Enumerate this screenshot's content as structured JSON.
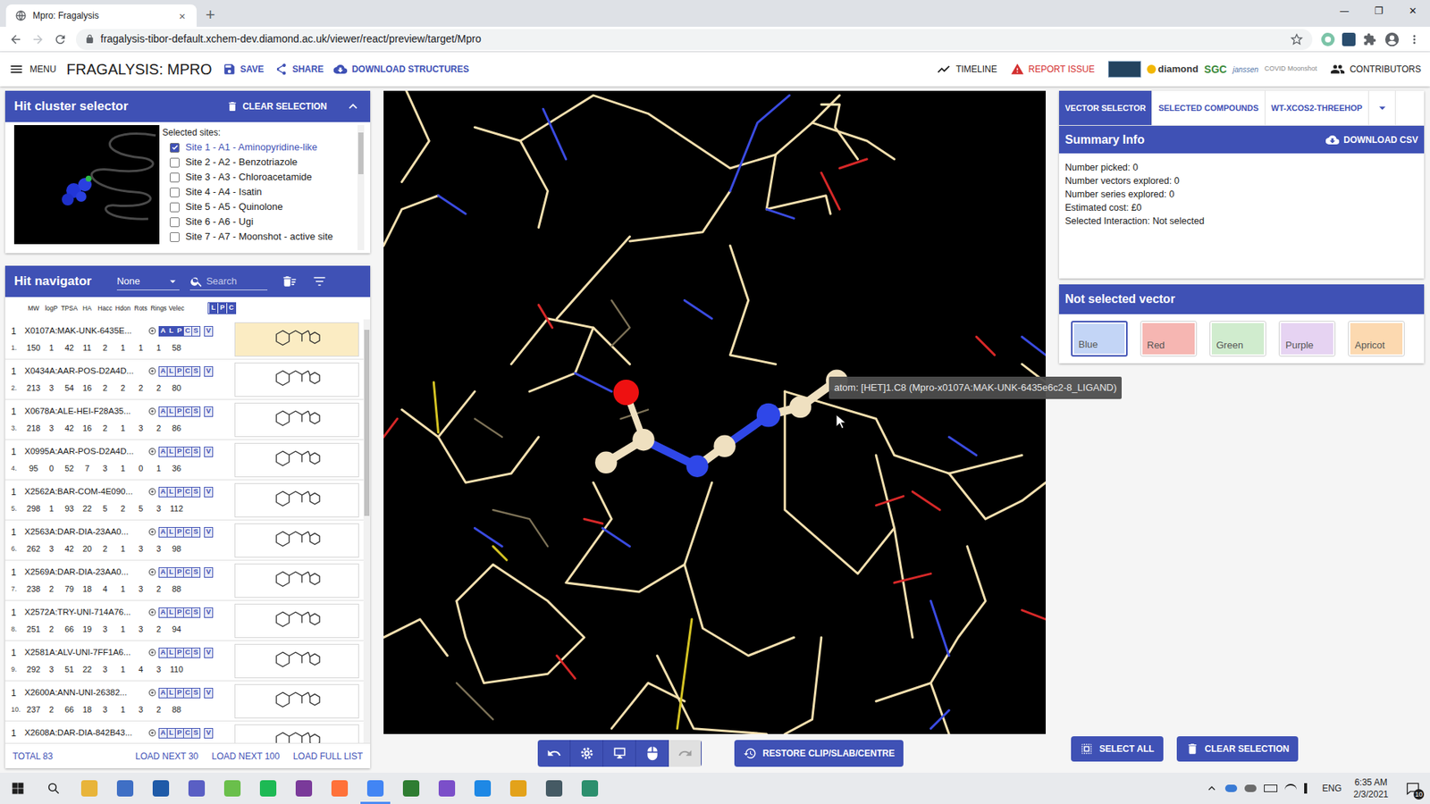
{
  "browser": {
    "tab_title": "Mpro: Fragalysis",
    "tab_close": "×",
    "new_tab": "+",
    "window_controls": [
      "—",
      "❐",
      "✕"
    ],
    "url": "fragalysis-tibor-default.xchem-dev.diamond.ac.uk/viewer/react/preview/target/Mpro"
  },
  "app_header": {
    "menu": "MENU",
    "title": "FRAGALYSIS: MPRO",
    "actions": [
      "SAVE",
      "SHARE",
      "DOWNLOAD STRUCTURES"
    ],
    "timeline": "TIMELINE",
    "report_issue": "REPORT ISSUE",
    "logos": [
      "diamond",
      "SGC",
      "janssen",
      "COVID Moonshot"
    ],
    "contributors": "CONTRIBUTORS"
  },
  "hit_cluster_selector": {
    "title": "Hit cluster selector",
    "clear": "CLEAR SELECTION",
    "sites_label": "Selected sites:",
    "sites": [
      {
        "label": "Site 1 - A1 - Aminopyridine-like",
        "checked": true
      },
      {
        "label": "Site 2 - A2 - Benzotriazole",
        "checked": false
      },
      {
        "label": "Site 3 - A3 - Chloroacetamide",
        "checked": false
      },
      {
        "label": "Site 4 - A4 - Isatin",
        "checked": false
      },
      {
        "label": "Site 5 - A5 - Quinolone",
        "checked": false
      },
      {
        "label": "Site 6 - A6 - Ugi",
        "checked": false
      },
      {
        "label": "Site 7 - A7 - Moonshot - active site",
        "checked": false
      }
    ]
  },
  "hit_navigator": {
    "title": "Hit navigator",
    "filter": "None",
    "search_placeholder": "Search",
    "columns": [
      "MW",
      "logP",
      "TPSA",
      "HA",
      "Hacc",
      "Hdon",
      "Rots",
      "Rings",
      "Velec"
    ],
    "header_badges": [
      "L",
      "P",
      "C"
    ],
    "rows": [
      {
        "count": "1",
        "name": "X0107A:MAK-UNK-6435E...",
        "index": "1.",
        "values": [
          "150",
          "1",
          "42",
          "11",
          "2",
          "1",
          "1",
          "1",
          "58"
        ],
        "selected": true,
        "badges": [
          {
            "label": "A",
            "on": true
          },
          {
            "label": "L",
            "on": true
          },
          {
            "label": "P",
            "on": true
          },
          {
            "label": "C",
            "on": false
          },
          {
            "label": "S",
            "on": false
          },
          {
            "label": "V",
            "on": false
          }
        ]
      },
      {
        "count": "1",
        "name": "X0434A:AAR-POS-D2A4D...",
        "index": "2.",
        "values": [
          "213",
          "3",
          "54",
          "16",
          "2",
          "2",
          "2",
          "2",
          "80"
        ],
        "selected": false,
        "badges": [
          {
            "label": "A",
            "on": false
          },
          {
            "label": "L",
            "on": false
          },
          {
            "label": "P",
            "on": false
          },
          {
            "label": "C",
            "on": false
          },
          {
            "label": "S",
            "on": false
          },
          {
            "label": "V",
            "on": false
          }
        ]
      },
      {
        "count": "1",
        "name": "X0678A:ALE-HEI-F28A35...",
        "index": "3.",
        "values": [
          "218",
          "3",
          "42",
          "16",
          "2",
          "1",
          "3",
          "2",
          "86"
        ],
        "selected": false,
        "badges": [
          {
            "label": "A",
            "on": false
          },
          {
            "label": "L",
            "on": false
          },
          {
            "label": "P",
            "on": false
          },
          {
            "label": "C",
            "on": false
          },
          {
            "label": "S",
            "on": false
          },
          {
            "label": "V",
            "on": false
          }
        ]
      },
      {
        "count": "1",
        "name": "X0995A:AAR-POS-D2A4D...",
        "index": "4.",
        "values": [
          "95",
          "0",
          "52",
          "7",
          "3",
          "1",
          "0",
          "1",
          "36"
        ],
        "selected": false,
        "badges": [
          {
            "label": "A",
            "on": false
          },
          {
            "label": "L",
            "on": false
          },
          {
            "label": "P",
            "on": false
          },
          {
            "label": "C",
            "on": false
          },
          {
            "label": "S",
            "on": false
          },
          {
            "label": "V",
            "on": false
          }
        ]
      },
      {
        "count": "1",
        "name": "X2562A:BAR-COM-4E090...",
        "index": "5.",
        "values": [
          "298",
          "1",
          "93",
          "22",
          "5",
          "2",
          "5",
          "3",
          "112"
        ],
        "selected": false,
        "badges": [
          {
            "label": "A",
            "on": false
          },
          {
            "label": "L",
            "on": false
          },
          {
            "label": "P",
            "on": false
          },
          {
            "label": "C",
            "on": false
          },
          {
            "label": "S",
            "on": false
          },
          {
            "label": "V",
            "on": false
          }
        ]
      },
      {
        "count": "1",
        "name": "X2563A:DAR-DIA-23AA0...",
        "index": "6.",
        "values": [
          "262",
          "3",
          "42",
          "20",
          "2",
          "1",
          "3",
          "3",
          "98"
        ],
        "selected": false,
        "badges": [
          {
            "label": "A",
            "on": false
          },
          {
            "label": "L",
            "on": false
          },
          {
            "label": "P",
            "on": false
          },
          {
            "label": "C",
            "on": false
          },
          {
            "label": "S",
            "on": false
          },
          {
            "label": "V",
            "on": false
          }
        ]
      },
      {
        "count": "1",
        "name": "X2569A:DAR-DIA-23AA0...",
        "index": "7.",
        "values": [
          "238",
          "2",
          "79",
          "18",
          "4",
          "1",
          "3",
          "2",
          "88"
        ],
        "selected": false,
        "badges": [
          {
            "label": "A",
            "on": false
          },
          {
            "label": "L",
            "on": false
          },
          {
            "label": "P",
            "on": false
          },
          {
            "label": "C",
            "on": false
          },
          {
            "label": "S",
            "on": false
          },
          {
            "label": "V",
            "on": false
          }
        ]
      },
      {
        "count": "1",
        "name": "X2572A:TRY-UNI-714A76...",
        "index": "8.",
        "values": [
          "251",
          "2",
          "66",
          "19",
          "3",
          "1",
          "3",
          "2",
          "94"
        ],
        "selected": false,
        "badges": [
          {
            "label": "A",
            "on": false
          },
          {
            "label": "L",
            "on": false
          },
          {
            "label": "P",
            "on": false
          },
          {
            "label": "C",
            "on": false
          },
          {
            "label": "S",
            "on": false
          },
          {
            "label": "V",
            "on": false
          }
        ]
      },
      {
        "count": "1",
        "name": "X2581A:ALV-UNI-7FF1A6...",
        "index": "9.",
        "values": [
          "292",
          "3",
          "51",
          "22",
          "3",
          "1",
          "4",
          "3",
          "110"
        ],
        "selected": false,
        "badges": [
          {
            "label": "A",
            "on": false
          },
          {
            "label": "L",
            "on": false
          },
          {
            "label": "P",
            "on": false
          },
          {
            "label": "C",
            "on": false
          },
          {
            "label": "S",
            "on": false
          },
          {
            "label": "V",
            "on": false
          }
        ]
      },
      {
        "count": "1",
        "name": "X2600A:ANN-UNI-26382...",
        "index": "10.",
        "values": [
          "237",
          "2",
          "66",
          "18",
          "3",
          "1",
          "3",
          "2",
          "88"
        ],
        "selected": false,
        "badges": [
          {
            "label": "A",
            "on": false
          },
          {
            "label": "L",
            "on": false
          },
          {
            "label": "P",
            "on": false
          },
          {
            "label": "C",
            "on": false
          },
          {
            "label": "S",
            "on": false
          },
          {
            "label": "V",
            "on": false
          }
        ]
      },
      {
        "count": "1",
        "name": "X2608A:DAR-DIA-842B43...",
        "index": "",
        "values": [],
        "selected": false,
        "badges": [
          {
            "label": "A",
            "on": false
          },
          {
            "label": "L",
            "on": false
          },
          {
            "label": "P",
            "on": false
          },
          {
            "label": "C",
            "on": false
          },
          {
            "label": "S",
            "on": false
          },
          {
            "label": "V",
            "on": false
          }
        ]
      }
    ],
    "total": "TOTAL 83",
    "load_buttons": [
      "LOAD NEXT 30",
      "LOAD NEXT 100",
      "LOAD FULL LIST"
    ]
  },
  "viewer": {
    "tooltip": "atom: [HET]1.C8 (Mpro-x0107A:MAK-UNK-6435e6c2-8_LIGAND)",
    "controls": [
      {
        "kind": "undo",
        "disabled": false
      },
      {
        "kind": "settings",
        "disabled": false
      },
      {
        "kind": "display",
        "disabled": false
      },
      {
        "kind": "mouse",
        "disabled": false
      },
      {
        "kind": "redo",
        "disabled": true
      }
    ],
    "restore": "RESTORE CLIP/SLAB/CENTRE"
  },
  "right_panel": {
    "tabs": [
      {
        "label": "VECTOR SELECTOR",
        "selected": true
      },
      {
        "label": "SELECTED COMPOUNDS",
        "selected": false
      },
      {
        "label": "WT-XCOS2-THREEHOP",
        "selected": false
      }
    ],
    "summary_title": "Summary Info",
    "download_csv": "DOWNLOAD CSV",
    "summary_lines": [
      "Number picked: 0",
      "Number vectors explored: 0",
      "Number series explored: 0",
      "Estimated cost: £0",
      "Selected Interaction: Not selected"
    ],
    "vector_title": "Not selected vector",
    "vectors": [
      {
        "label": "Blue",
        "selected": true,
        "color": "#c3d5f6"
      },
      {
        "label": "Red",
        "selected": false,
        "color": "#f6b6b2"
      },
      {
        "label": "Green",
        "selected": false,
        "color": "#d0ecce"
      },
      {
        "label": "Purple",
        "selected": false,
        "color": "#e6d3f2"
      },
      {
        "label": "Apricot",
        "selected": false,
        "color": "#fcd9b0"
      }
    ],
    "select_all": "SELECT ALL",
    "clear_selection": "CLEAR SELECTION"
  },
  "taskbar": {
    "language": "ENG",
    "time": "6:35 AM",
    "date": "2/3/2021",
    "notifications": "10"
  }
}
